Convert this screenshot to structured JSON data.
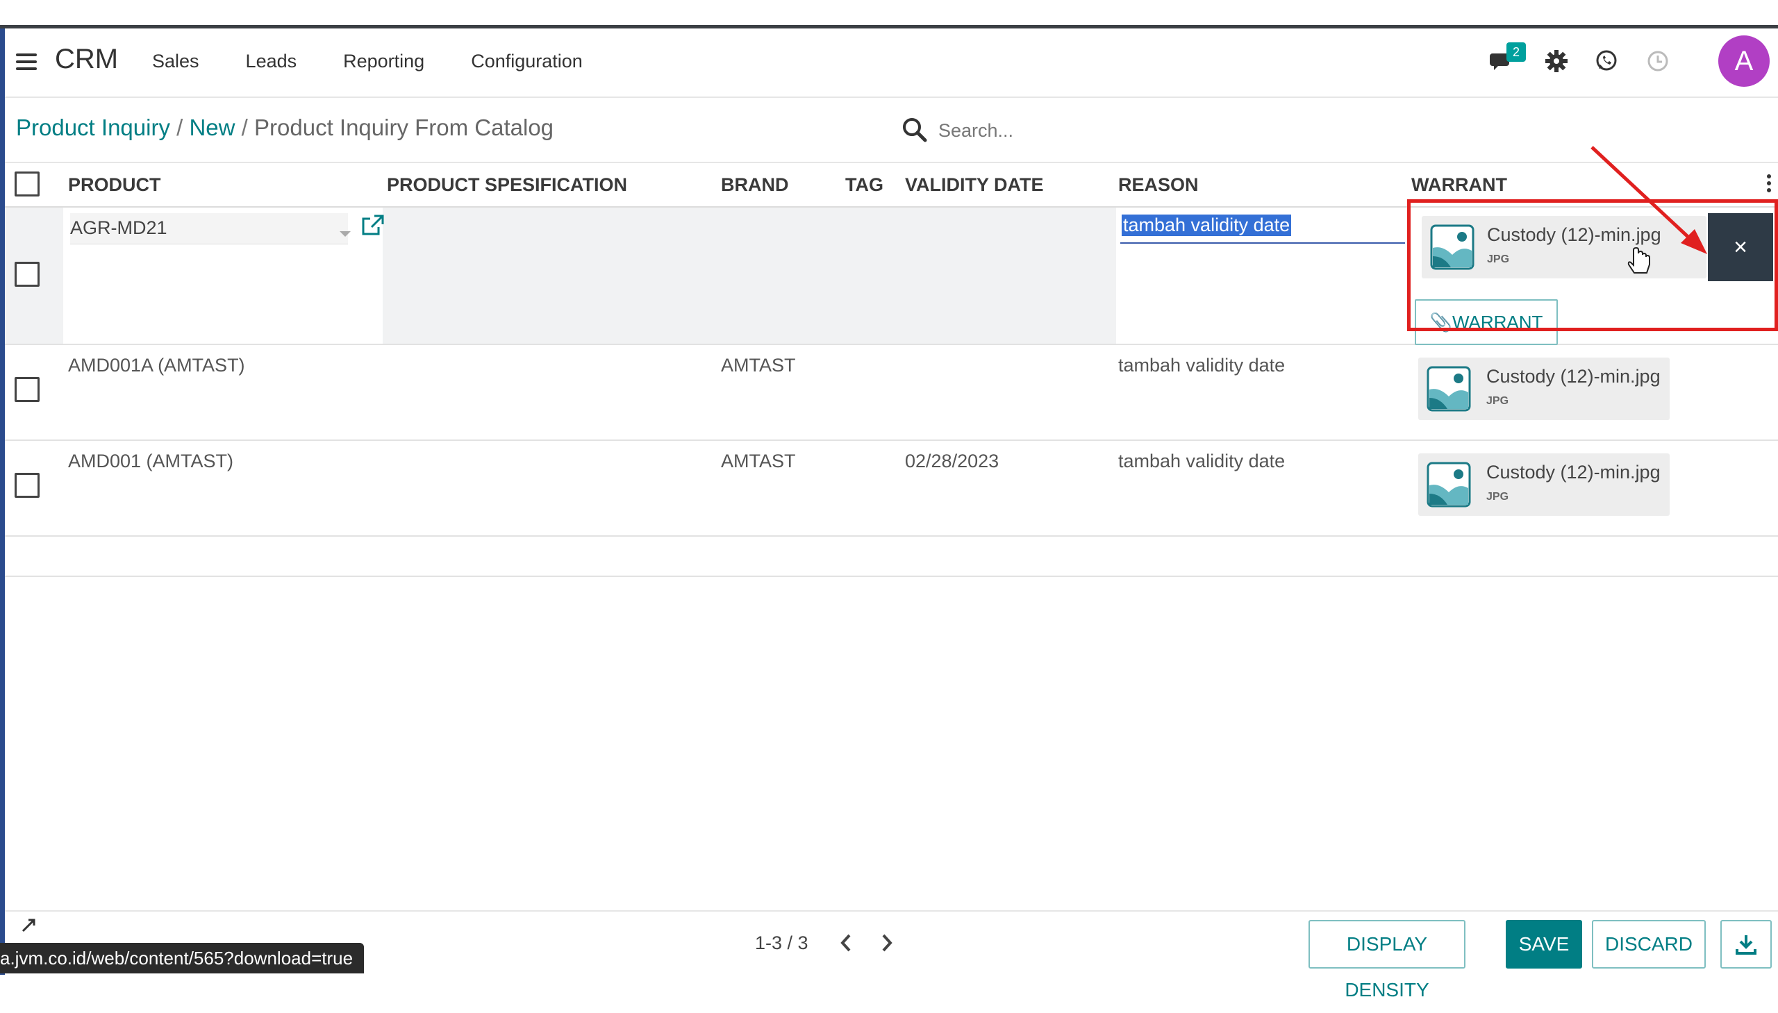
{
  "navbar": {
    "app_name": "CRM",
    "menu": [
      "Sales",
      "Leads",
      "Reporting",
      "Configuration"
    ],
    "messages_badge": "2",
    "avatar_letter": "A",
    "icons": [
      "menu-icon",
      "chat-icon",
      "gear-icon",
      "whatsapp-icon",
      "clock-icon"
    ]
  },
  "breadcrumb": {
    "part1": "Product Inquiry",
    "sep": " / ",
    "part2": "New",
    "current": "Product Inquiry From Catalog"
  },
  "search": {
    "placeholder": "Search..."
  },
  "table": {
    "headers": {
      "product": "PRODUCT",
      "spec": "PRODUCT SPESIFICATION",
      "brand": "BRAND",
      "tag": "TAG",
      "validity": "VALIDITY DATE",
      "reason": "REASON",
      "warrant": "WARRANT"
    },
    "edit_row": {
      "product": "AGR-MD21",
      "reason": "tambah validity date",
      "attachment_name": "Custody (12)-min.jpg",
      "attachment_type": "JPG",
      "delete_label": "×",
      "warrant_button": "📎WARRANT"
    },
    "rows": [
      {
        "product": "AMD001A (AMTAST)",
        "brand": "AMTAST",
        "validity": "",
        "reason": "tambah validity date",
        "attachment_name": "Custody (12)-min.jpg",
        "attachment_type": "JPG"
      },
      {
        "product": "AMD001 (AMTAST)",
        "brand": "AMTAST",
        "validity": "02/28/2023",
        "reason": "tambah validity date",
        "attachment_name": "Custody (12)-min.jpg",
        "attachment_type": "JPG"
      }
    ]
  },
  "footer": {
    "pager": "1-3 / 3",
    "display_density": "DISPLAY DENSITY",
    "save": "SAVE",
    "discard": "DISCARD"
  },
  "statusbar": {
    "url": "a.jvm.co.id/web/content/565?download=true"
  },
  "colors": {
    "accent": "#017e84",
    "highlight": "#e0201f",
    "avatar": "#b13fc4",
    "delete": "#2e3a46"
  }
}
